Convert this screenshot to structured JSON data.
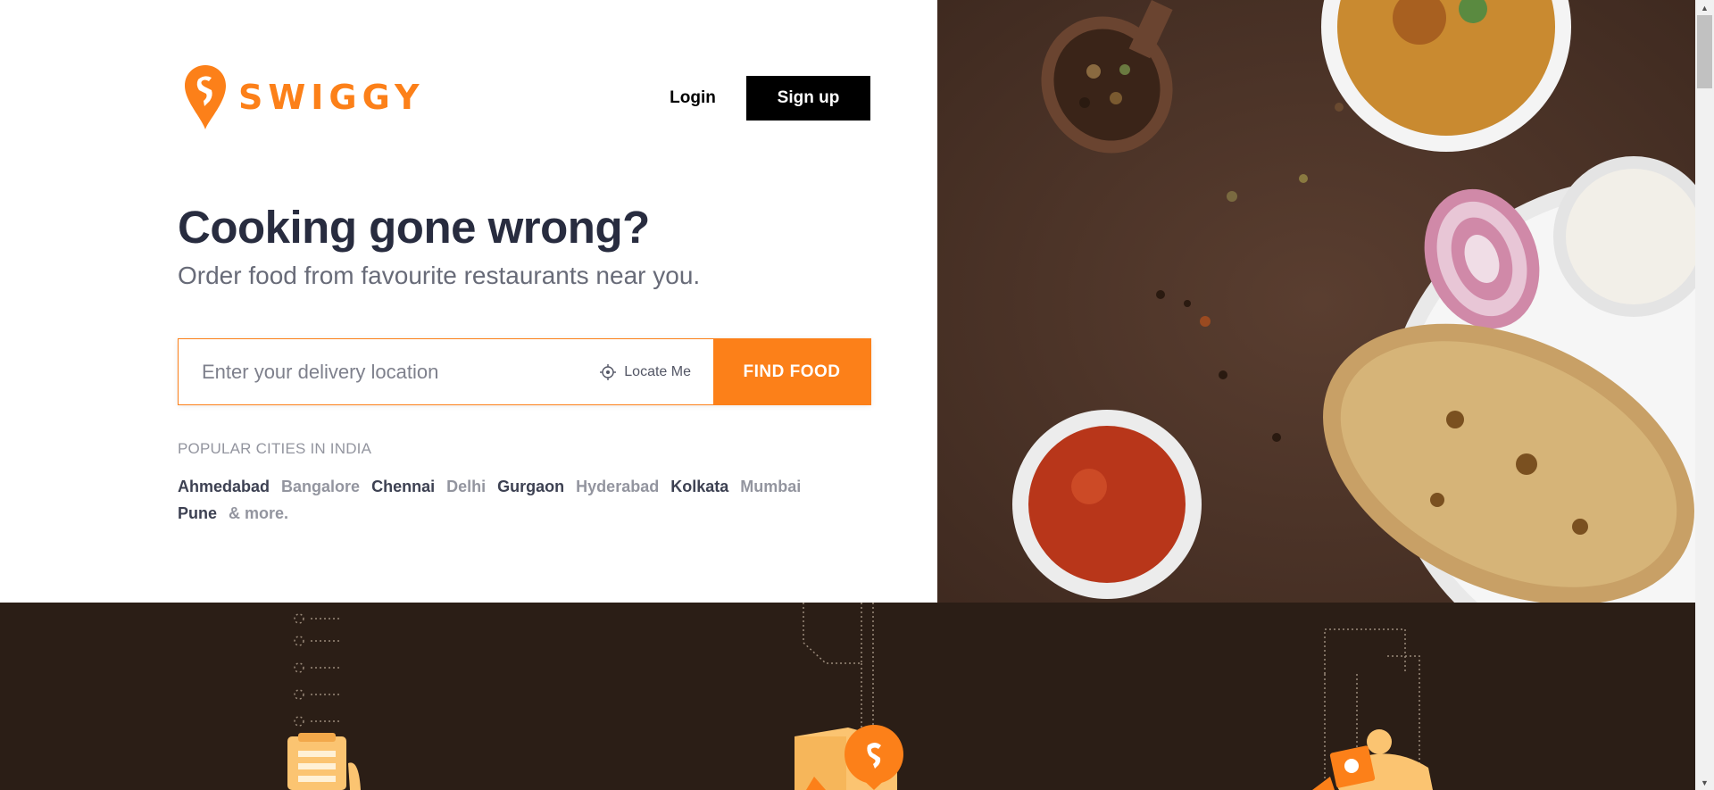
{
  "brand": {
    "name": "SWIGGY",
    "color": "#fc8019"
  },
  "header": {
    "login_label": "Login",
    "signup_label": "Sign up"
  },
  "hero": {
    "headline": "Cooking gone wrong?",
    "subhead": "Order food from favourite restaurants near you."
  },
  "search": {
    "placeholder": "Enter your delivery location",
    "locate_label": "Locate Me",
    "find_food_label": "FIND FOOD"
  },
  "popular_cities": {
    "label": "POPULAR CITIES IN INDIA",
    "cities": [
      "Ahmedabad",
      "Bangalore",
      "Chennai",
      "Delhi",
      "Gurgaon",
      "Hyderabad",
      "Kolkata",
      "Mumbai",
      "Pune"
    ],
    "more_label": "& more."
  },
  "icons": [
    "swiggy-logo-icon",
    "locate-icon",
    "scroll-up-icon",
    "scroll-down-icon"
  ],
  "colors": {
    "accent": "#fc8019",
    "text_dark": "#282c3f",
    "text_gray": "#686b78",
    "band_dark": "#2b1e16"
  }
}
